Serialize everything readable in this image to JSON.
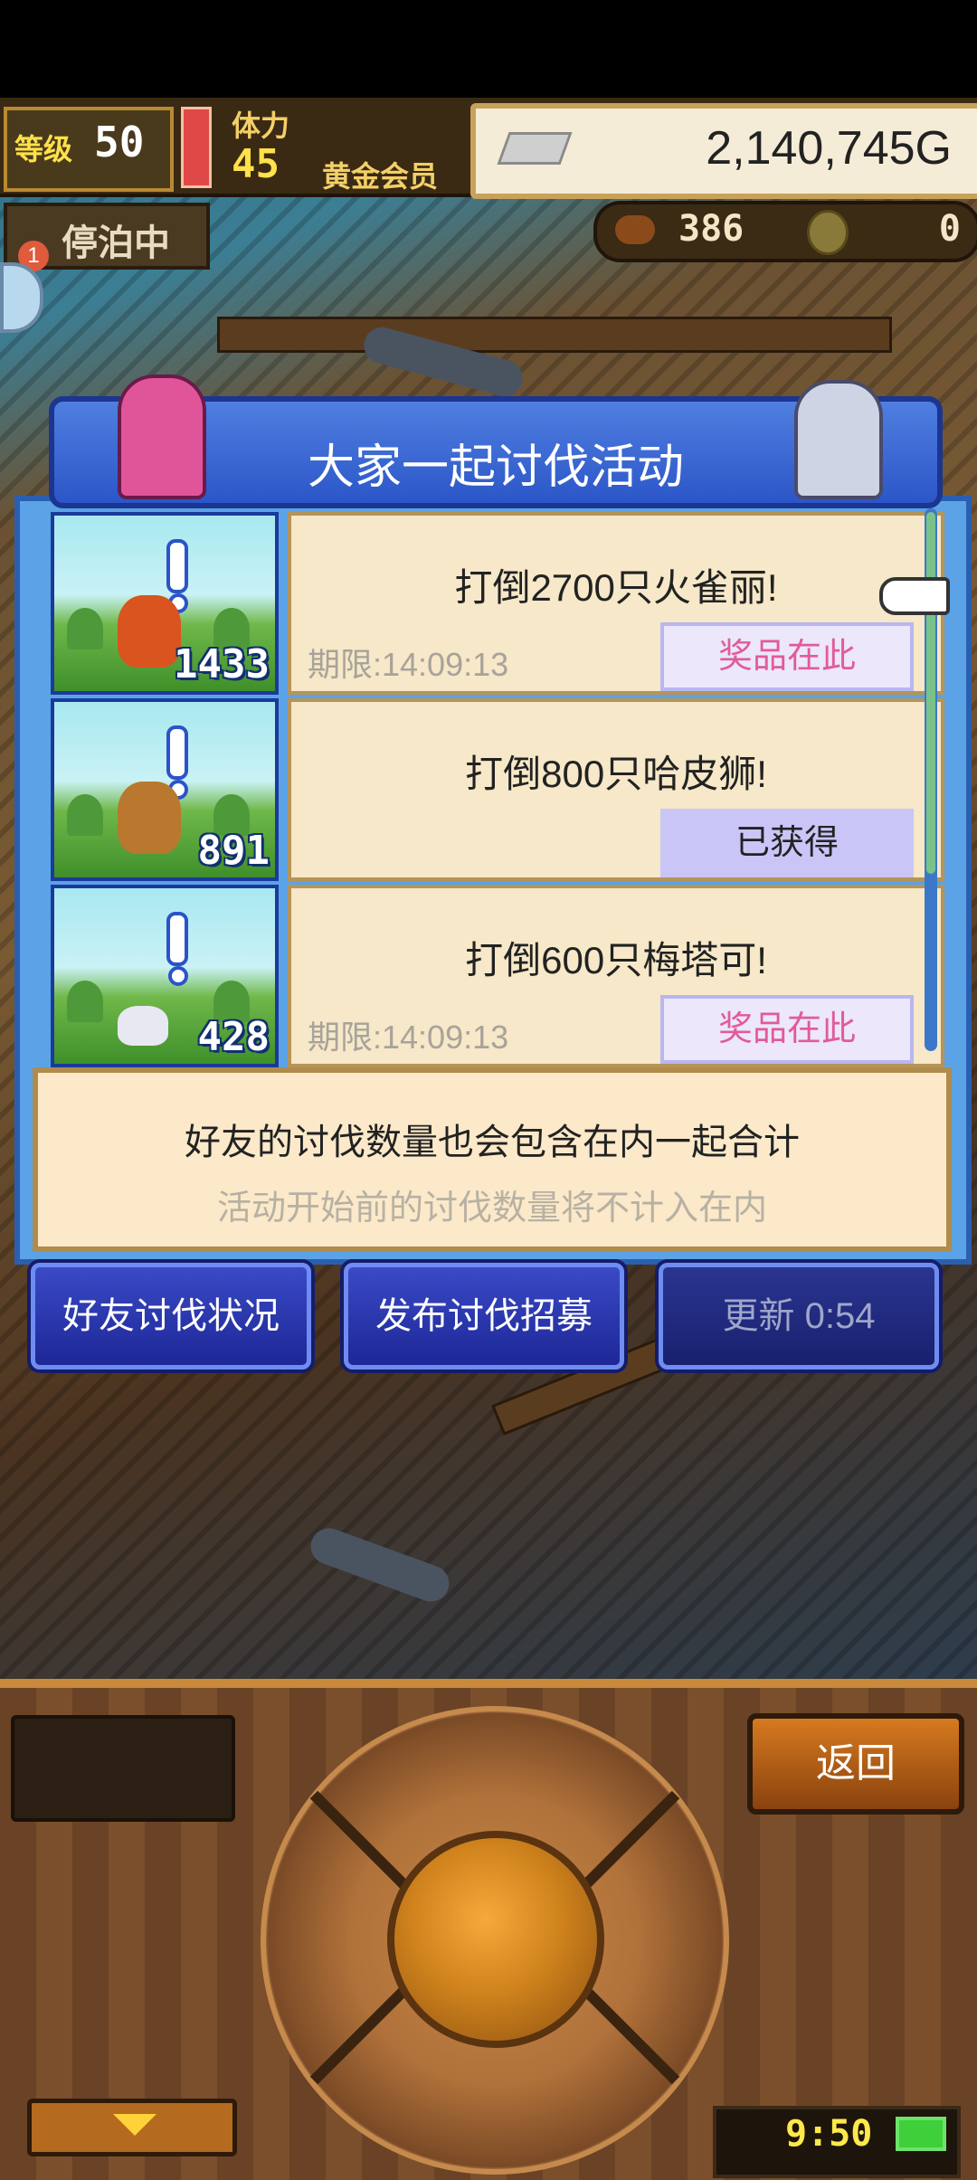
{
  "hud": {
    "level_label": "等级",
    "level_value": "50",
    "stamina_label": "体力",
    "stamina_value": "45",
    "membership": "黄金会员",
    "gold": "2,140,745G",
    "status": "停泊中",
    "notification_count": "1",
    "food_count": "386",
    "coin_count": "0"
  },
  "panel": {
    "title": "大家一起讨伐活动",
    "quests": [
      {
        "text": "打倒2700只火雀丽!",
        "deadline": "期限:14:09:13",
        "reward": "奖品在此",
        "count": "1433",
        "monster_color": "#d9541e"
      },
      {
        "text": "打倒800只哈皮狮!",
        "deadline": "",
        "reward": "已获得",
        "count": "891",
        "monster_color": "#b9782e"
      },
      {
        "text": "打倒600只梅塔可!",
        "deadline": "期限:14:09:13",
        "reward": "奖品在此",
        "count": "428",
        "monster_color": "#e8e8f2"
      }
    ],
    "note_main": "好友的讨伐数量也会包含在内一起合计",
    "note_sub": "活动开始前的讨伐数量将不计入在内"
  },
  "buttons": {
    "friend_status": "好友讨伐状况",
    "post_recruit": "发布讨伐招募",
    "refresh": "更新 0:54",
    "back": "返回"
  },
  "clock": "9:50",
  "colors": {
    "panel_blue": "#2c56c8",
    "reward_pink": "#e15b9a",
    "card_bg": "#f6e8c8"
  }
}
